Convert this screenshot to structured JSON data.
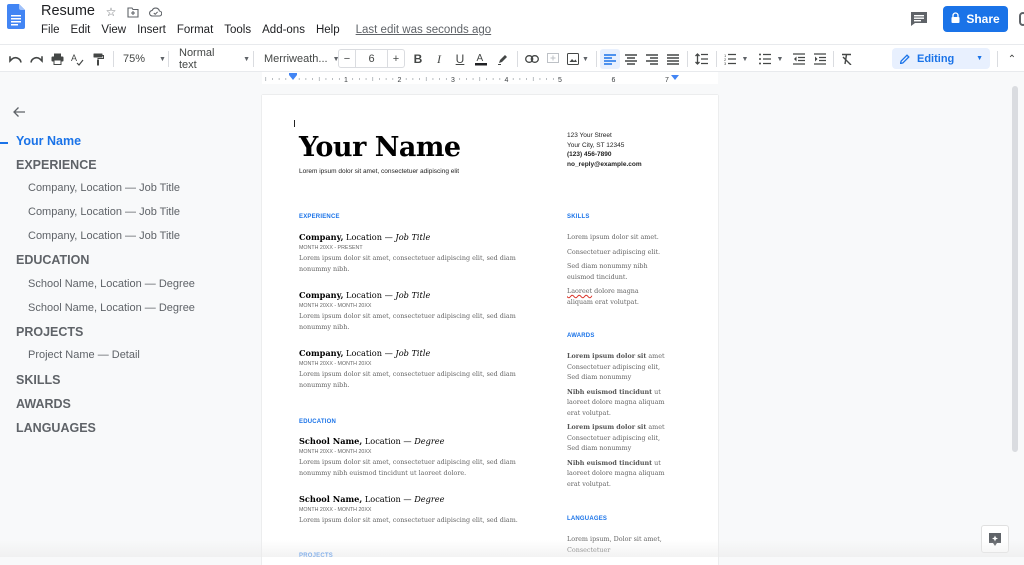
{
  "app": {
    "title": "Resume",
    "menu": [
      "File",
      "Edit",
      "View",
      "Insert",
      "Format",
      "Tools",
      "Add-ons",
      "Help"
    ],
    "last_edit": "Last edit was seconds ago",
    "share_label": "Share",
    "title_icons": [
      "star-icon",
      "move-to-folder-icon",
      "cloud-saved-icon"
    ]
  },
  "toolbar": {
    "zoom": "75%",
    "style": "Normal text",
    "font": "Merriweath...",
    "font_size": "6",
    "minus": "−",
    "plus": "+",
    "mode": "Editing",
    "active_alignment": "left"
  },
  "ruler": {
    "ticks": [
      "1",
      "2",
      "3",
      "4",
      "5",
      "6",
      "7"
    ]
  },
  "outline": {
    "items": [
      {
        "label": "Your Name",
        "level": "title",
        "active": true
      },
      {
        "label": "EXPERIENCE",
        "level": "h1"
      },
      {
        "label": "Company, Location — Job Title",
        "level": "h2"
      },
      {
        "label": "Company, Location — Job Title",
        "level": "h2"
      },
      {
        "label": "Company, Location — Job Title",
        "level": "h2"
      },
      {
        "label": "EDUCATION",
        "level": "h1"
      },
      {
        "label": "School Name, Location — Degree",
        "level": "h2"
      },
      {
        "label": "School Name, Location — Degree",
        "level": "h2"
      },
      {
        "label": "PROJECTS",
        "level": "h1"
      },
      {
        "label": "Project Name — Detail",
        "level": "h2"
      },
      {
        "label": "SKILLS",
        "level": "h1"
      },
      {
        "label": "AWARDS",
        "level": "h1"
      },
      {
        "label": "LANGUAGES",
        "level": "h1"
      }
    ]
  },
  "document": {
    "name": "Your Name",
    "subtitle": "Lorem ipsum dolor sit amet, consectetuer adipiscing elit",
    "contact": {
      "street": "123 Your Street",
      "city": "Your City, ST 12345",
      "phone": "(123) 456-7890",
      "email": "no_reply@example.com"
    },
    "experience": {
      "heading": "EXPERIENCE",
      "entries": [
        {
          "org": "Company,",
          "loc": " Location — ",
          "role": "Job Title",
          "dates": "MONTH 20XX - PRESENT",
          "desc": "Lorem ipsum dolor sit amet, consectetuer adipiscing elit, sed diam nonummy nibh."
        },
        {
          "org": "Company,",
          "loc": " Location — ",
          "role": "Job Title",
          "dates": "MONTH 20XX - MONTH 20XX",
          "desc": "Lorem ipsum dolor sit amet, consectetuer adipiscing elit, sed diam nonummy nibh."
        },
        {
          "org": "Company,",
          "loc": " Location — ",
          "role": "Job Title",
          "dates": "MONTH 20XX - MONTH 20XX",
          "desc": "Lorem ipsum dolor sit amet, consectetuer adipiscing elit, sed diam nonummy nibh."
        }
      ]
    },
    "education": {
      "heading": "EDUCATION",
      "entries": [
        {
          "org": "School Name,",
          "loc": " Location — ",
          "role": "Degree",
          "dates": "MONTH 20XX - MONTH 20XX",
          "desc": "Lorem ipsum dolor sit amet, consectetuer adipiscing elit, sed diam nonummy nibh euismod tincidunt ut laoreet dolore."
        },
        {
          "org": "School Name,",
          "loc": " Location — ",
          "role": "Degree",
          "dates": "MONTH 20XX - MONTH 20XX",
          "desc": "Lorem ipsum dolor sit amet, consectetuer adipiscing elit, sed diam."
        }
      ]
    },
    "projects": {
      "heading": "PROJECTS"
    },
    "skills": {
      "heading": "SKILLS",
      "items": [
        "Lorem ipsum dolor sit amet.",
        "Consectetuer adipiscing elit.",
        "Sed diam nonummy nibh euismod tincidunt."
      ],
      "last_misspelled": "Laoreet",
      "last_rest": " dolore magna aliquam erat volutpat."
    },
    "awards": {
      "heading": "AWARDS",
      "items": [
        {
          "bold": "Lorem ipsum dolor sit",
          "rest": " amet Consectetuer adipiscing elit, Sed diam nonummy"
        },
        {
          "bold": "Nibh euismod tincidunt",
          "rest": " ut laoreet dolore magna aliquam erat volutpat."
        },
        {
          "bold": "Lorem ipsum dolor sit",
          "rest": " amet Consectetuer adipiscing elit, Sed diam nonummy"
        },
        {
          "bold": "Nibh euismod tincidunt",
          "rest": " ut laoreet dolore magna aliquam erat volutpat."
        }
      ]
    },
    "languages": {
      "heading": "LANGUAGES",
      "text": "Lorem ipsum, Dolor sit amet, Consectetuer"
    }
  },
  "colors": {
    "accent": "#1a73e8",
    "heading_blue": "#1a73e8",
    "background": "#f8f9fa"
  }
}
